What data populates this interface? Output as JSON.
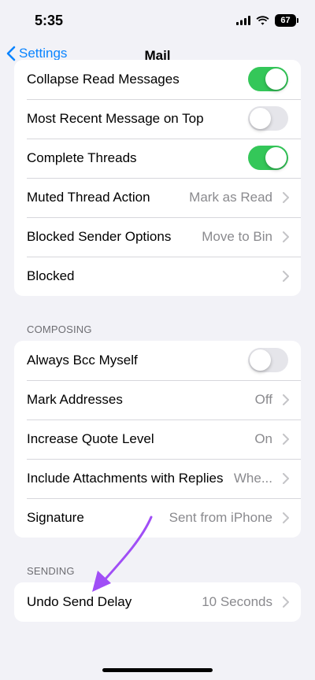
{
  "status_bar": {
    "time": "5:35",
    "battery": "67"
  },
  "nav": {
    "back_label": "Settings",
    "title": "Mail"
  },
  "threading": [
    {
      "label": "Collapse Read Messages",
      "type": "toggle",
      "on": true
    },
    {
      "label": "Most Recent Message on Top",
      "type": "toggle",
      "on": false
    },
    {
      "label": "Complete Threads",
      "type": "toggle",
      "on": true
    },
    {
      "label": "Muted Thread Action",
      "type": "link",
      "value": "Mark as Read"
    },
    {
      "label": "Blocked Sender Options",
      "type": "link",
      "value": "Move to Bin"
    },
    {
      "label": "Blocked",
      "type": "link",
      "value": ""
    }
  ],
  "composing": {
    "header": "COMPOSING",
    "rows": [
      {
        "label": "Always Bcc Myself",
        "type": "toggle",
        "on": false
      },
      {
        "label": "Mark Addresses",
        "type": "link",
        "value": "Off"
      },
      {
        "label": "Increase Quote Level",
        "type": "link",
        "value": "On"
      },
      {
        "label": "Include Attachments with Replies",
        "type": "link",
        "value": "Whe..."
      },
      {
        "label": "Signature",
        "type": "link",
        "value": "Sent from iPhone"
      }
    ]
  },
  "sending": {
    "header": "SENDING",
    "rows": [
      {
        "label": "Undo Send Delay",
        "type": "link",
        "value": "10 Seconds"
      }
    ]
  },
  "colors": {
    "accent": "#0a84ff",
    "toggle_on": "#34c759",
    "annotation_arrow": "#a04ef6"
  }
}
